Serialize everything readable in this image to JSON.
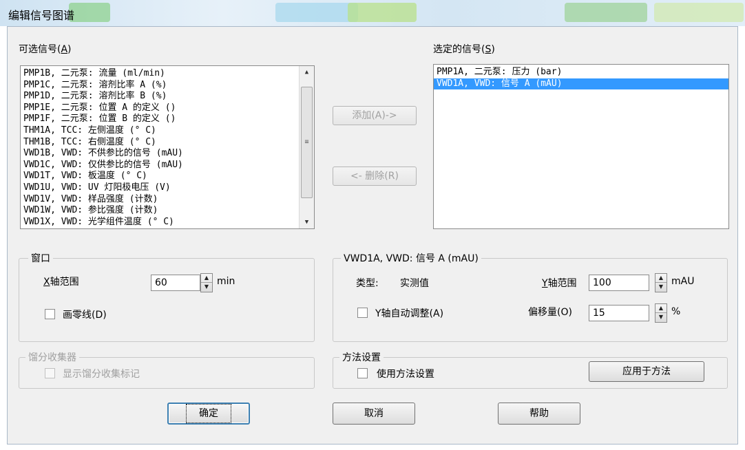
{
  "window": {
    "title": "编辑信号图谱",
    "titlebar_tints": [
      "#8fd28f",
      "#a8d8ee",
      "#b8e08a",
      "#9fd39a",
      "#d2eab0"
    ]
  },
  "available_signals": {
    "label": "可选信号",
    "mnemonic": "A",
    "items": [
      "PMP1B, 二元泵: 流量 (ml/min)",
      "PMP1C, 二元泵: 溶剂比率 A (%)",
      "PMP1D, 二元泵: 溶剂比率 B (%)",
      "PMP1E, 二元泵: 位置 A 的定义 ()",
      "PMP1F, 二元泵: 位置 B 的定义 ()",
      "THM1A, TCC: 左侧温度 (° C)",
      "THM1B, TCC: 右侧温度 (° C)",
      "VWD1B, VWD: 不供参比的信号 (mAU)",
      "VWD1C, VWD: 仅供参比的信号 (mAU)",
      "VWD1T, VWD: 板温度 (° C)",
      "VWD1U, VWD: UV 灯阳极电压 (V)",
      "VWD1V, VWD: 样品强度 (计数)",
      "VWD1W, VWD: 参比强度 (计数)",
      "VWD1X, VWD: 光学组件温度 (° C)"
    ]
  },
  "selected_signals": {
    "label": "选定的信号",
    "mnemonic": "S",
    "items": [
      "PMP1A, 二元泵: 压力 (bar)",
      "VWD1A, VWD: 信号 A (mAU)"
    ],
    "selected_index": 1
  },
  "buttons": {
    "add": "添加(A)->",
    "remove": "<- 删除(R)",
    "ok": "确定",
    "cancel": "取消",
    "help": "帮助",
    "apply_to_method": "应用于方法"
  },
  "window_group": {
    "title": "窗口",
    "x_range_label": "X轴范围",
    "x_range_value": "60",
    "x_range_unit": "min",
    "zero_line_label": "画零线(D)",
    "zero_line_checked": false
  },
  "signal_group": {
    "title": "VWD1A, VWD: 信号 A (mAU)",
    "type_label": "类型:",
    "type_value": "实测值",
    "y_range_label": "Y轴范围",
    "y_range_value": "100",
    "y_range_unit": "mAU",
    "y_auto_label": "Y轴自动调整(A)",
    "y_auto_checked": false,
    "offset_label": "偏移量(O)",
    "offset_value": "15",
    "offset_unit": "%"
  },
  "fraction_group": {
    "title": "馏分收集器",
    "show_marks_label": "显示馏分收集标记",
    "enabled": false
  },
  "method_group": {
    "title": "方法设置",
    "use_method_label": "使用方法设置",
    "use_method_checked": false
  }
}
